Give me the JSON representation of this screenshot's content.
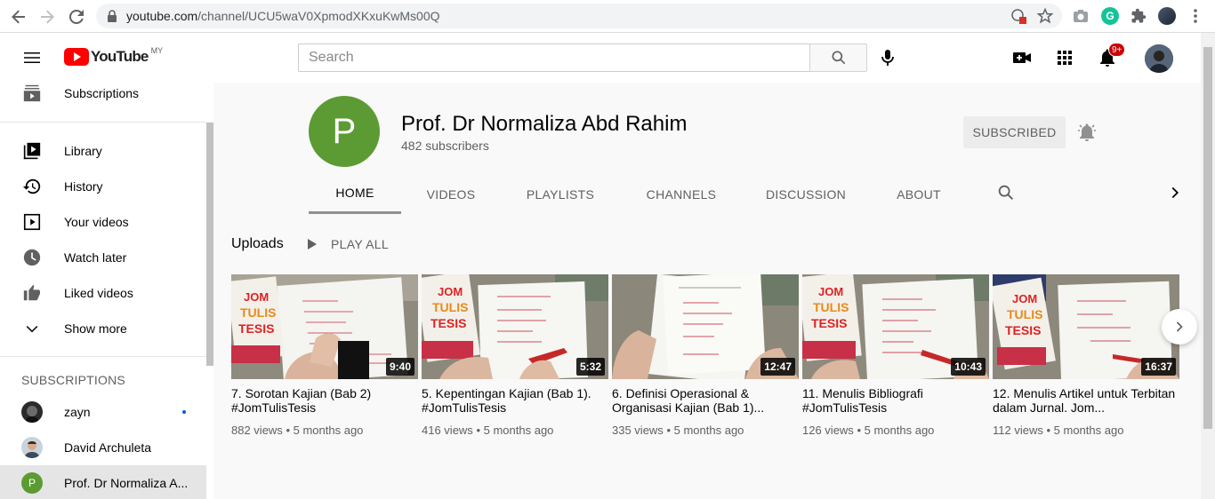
{
  "browser": {
    "url_host": "youtube.com",
    "url_path": "/channel/UCU5waV0XpmodXKxuKwMs00Q",
    "extension_letter": "G"
  },
  "masthead": {
    "logo_text": "YouTube",
    "country_code": "MY",
    "search_placeholder": "Search",
    "notification_count": "9+"
  },
  "sidebar": {
    "top_items": [
      {
        "label": "Subscriptions",
        "icon": "subscriptions-icon"
      }
    ],
    "library_items": [
      {
        "label": "Library",
        "icon": "library-icon"
      },
      {
        "label": "History",
        "icon": "history-icon"
      },
      {
        "label": "Your videos",
        "icon": "your-videos-icon"
      },
      {
        "label": "Watch later",
        "icon": "watch-later-icon"
      },
      {
        "label": "Liked videos",
        "icon": "thumbs-up-icon"
      },
      {
        "label": "Show more",
        "icon": "chevron-down-icon"
      }
    ],
    "subscriptions_heading": "SUBSCRIPTIONS",
    "subscriptions": [
      {
        "label": "zayn",
        "live": true,
        "avatar_letter": ""
      },
      {
        "label": "David Archuleta",
        "live": false,
        "avatar_letter": ""
      },
      {
        "label": "Prof. Dr Normaliza A...",
        "live": false,
        "avatar_letter": "P"
      }
    ]
  },
  "channel": {
    "avatar_letter": "P",
    "avatar_color": "#5c9b33",
    "name": "Prof. Dr Normaliza Abd Rahim",
    "subscribers": "482 subscribers",
    "subscribe_label": "SUBSCRIBED",
    "tabs": [
      "HOME",
      "VIDEOS",
      "PLAYLISTS",
      "CHANNELS",
      "DISCUSSION",
      "ABOUT"
    ],
    "active_tab": "HOME"
  },
  "uploads": {
    "title": "Uploads",
    "play_all_label": "PLAY ALL",
    "videos": [
      {
        "title": "7. Sorotan Kajian (Bab 2) #JomTulisTesis",
        "duration": "9:40",
        "views": "882 views",
        "age": "5 months ago"
      },
      {
        "title": "5. Kepentingan Kajian (Bab 1). #JomTulisTesis",
        "duration": "5:32",
        "views": "416 views",
        "age": "5 months ago"
      },
      {
        "title": "6. Definisi Operasional & Organisasi Kajian (Bab 1)...",
        "duration": "12:47",
        "views": "335 views",
        "age": "5 months ago"
      },
      {
        "title": "11. Menulis Bibliografi #JomTulisTesis",
        "duration": "10:43",
        "views": "126 views",
        "age": "5 months ago"
      },
      {
        "title": "12. Menulis Artikel untuk Terbitan dalam Jurnal. Jom...",
        "duration": "16:37",
        "views": "112 views",
        "age": "5 months ago"
      }
    ]
  },
  "meta_separator": "•"
}
